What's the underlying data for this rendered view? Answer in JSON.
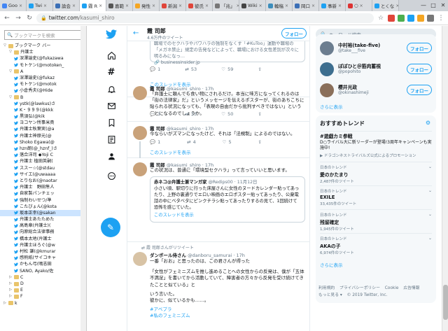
{
  "browser": {
    "tabs": [
      {
        "label": "Goo",
        "color": "#4285f4"
      },
      {
        "label": "Twi",
        "color": "#1da1f2"
      },
      {
        "label": "論会",
        "color": "#3b6fb6"
      },
      {
        "label": "霧 R",
        "color": "#1da1f2",
        "active": true
      },
      {
        "label": "嘉範",
        "color": "#555555"
      },
      {
        "label": "発性",
        "color": "#f5a623"
      },
      {
        "label": "新潟",
        "color": "#e0453a"
      },
      {
        "label": "彼氏",
        "color": "#e0453a"
      },
      {
        "label": "「兆」",
        "color": "#777777"
      },
      {
        "label": "Wiki",
        "color": "#444444"
      },
      {
        "label": "輪稿",
        "color": "#3c8dbc"
      },
      {
        "label": "岡口",
        "color": "#3b6fb6"
      },
      {
        "label": "事新",
        "color": "#1da1f2"
      },
      {
        "label": "○",
        "color": "#d33"
      },
      {
        "label": "とくな",
        "color": "#1da1f2"
      }
    ],
    "url_host": "twitter.com",
    "url_path": "/kasumi_shiro",
    "win_controls": [
      "—",
      "□",
      "✕"
    ],
    "ext_colors": [
      "#e0453a",
      "#4caf50",
      "#1da1f2",
      "#f5a623",
      "#777777"
    ]
  },
  "bookmarks": {
    "search_placeholder": "ブックマークを検索",
    "items": [
      {
        "text": "ブックマーク バー",
        "type": "folder",
        "depth": 0,
        "arrow": "▽"
      },
      {
        "text": "弁護士",
        "type": "folder",
        "depth": 1,
        "arrow": "▽"
      },
      {
        "text": "深澤諭史(@fukazawa",
        "type": "tw",
        "depth": 2
      },
      {
        "text": "モトケン(@motoken_",
        "type": "tw",
        "depth": 2
      },
      {
        "text": "A",
        "type": "folder",
        "depth": 1,
        "arrow": "▽"
      },
      {
        "text": "深澤諭史(@fukaz",
        "type": "tw",
        "depth": 2
      },
      {
        "text": "モトケン(@motok",
        "type": "tw",
        "depth": 2
      },
      {
        "text": "小倉秀夫(@Hide",
        "type": "tw",
        "depth": 2
      },
      {
        "text": "B",
        "type": "folder",
        "depth": 1,
        "arrow": "▽"
      },
      {
        "text": "ystk(@lawkus)さ",
        "type": "tw",
        "depth": 2
      },
      {
        "text": "K・９９９(@kkk",
        "type": "tw",
        "depth": 2
      },
      {
        "text": "黒須弘(@kik",
        "type": "tw",
        "depth": 2
      },
      {
        "text": "ヨコヤン所事米貴",
        "type": "tw",
        "depth": 2
      },
      {
        "text": "弁護士秋葉実(@a",
        "type": "tw",
        "depth": 2
      },
      {
        "text": "弁護士神原元(@",
        "type": "tw",
        "depth": 2
      },
      {
        "text": "Shoko Egawa(@",
        "type": "tw",
        "depth": 2
      },
      {
        "text": "hzn朗(@_hznf_)さ",
        "type": "tw",
        "depth": 2
      },
      {
        "text": "落合洋司 ◆Yoji C",
        "type": "tw",
        "depth": 2
      },
      {
        "text": "弁護士 植田英嗣(",
        "type": "tw",
        "depth": 2
      },
      {
        "text": "ススー☆(@stdau",
        "type": "tw",
        "depth": 2
      },
      {
        "text": "サイエ(@uwaaaa",
        "type": "tw",
        "depth": 2
      },
      {
        "text": "とりなお(@naotar",
        "type": "tw",
        "depth": 2
      },
      {
        "text": "弁護士　野田隼人",
        "type": "tw",
        "depth": 2
      },
      {
        "text": "自家製パンチェッ",
        "type": "tw",
        "depth": 2
      },
      {
        "text": "強制わいせつ/準",
        "type": "tw",
        "depth": 2
      },
      {
        "text": "こたびょん(@kota",
        "type": "tw",
        "depth": 2
      },
      {
        "text": "坂本正幸(@sakan",
        "type": "tw",
        "depth": 2,
        "selected": true
      },
      {
        "text": "弁護士あたためた",
        "type": "tw",
        "depth": 2
      },
      {
        "text": "高島章(弁護士)(",
        "type": "tw",
        "depth": 2
      },
      {
        "text": "向原総合法律事務",
        "type": "tw",
        "depth": 2
      },
      {
        "text": "橋本太地(弁護士",
        "type": "tw",
        "depth": 2
      },
      {
        "text": "弁護士ほろぐ(@w",
        "type": "tw",
        "depth": 2
      },
      {
        "text": "村松 謙(@kmurar",
        "type": "tw",
        "depth": 2
      },
      {
        "text": "感熱紙(サイコキャ",
        "type": "tw",
        "depth": 2
      },
      {
        "text": "かもん弓(鳴志田",
        "type": "tw",
        "depth": 2
      },
      {
        "text": "SANO, Ayako/佐",
        "type": "tw",
        "depth": 2
      },
      {
        "text": "C",
        "type": "folder",
        "depth": 1,
        "arrow": "▷"
      },
      {
        "text": "D",
        "type": "folder",
        "depth": 1,
        "arrow": "▷"
      },
      {
        "text": "E",
        "type": "folder",
        "depth": 1,
        "arrow": "▷"
      },
      {
        "text": "F",
        "type": "folder",
        "depth": 1,
        "arrow": "▷"
      },
      {
        "text": "k",
        "type": "folder",
        "depth": 0,
        "arrow": "▷"
      }
    ]
  },
  "profile": {
    "back": "←",
    "name": "霞 司郎",
    "tweet_count": "4.6万件のツイート",
    "follow_label": "フォロー"
  },
  "tweets": {
    "t0": {
      "body": "職場でのセクハラやパワハラの強制をなくす「#KuToo」運動や職場の「メガネ禁止」規定の告発などによって、職場における女性差別が次々に明るみになっ…",
      "link": "🔗 businessinsider.jp",
      "reply": "1",
      "retweet": "53",
      "like": "59",
      "show_thread": "このスレッドを表示"
    },
    "t1": {
      "name": "霞 司郎",
      "handle": "@kasumi_shiro",
      "time": "· 17h",
      "body": "「弁護士に頼んでも食い物にされるだけ。本当に味方になってくれるのは「街の法律家」だ」というメッセージを伝えるポスターが、街のあちこちに貼られる状況になっても、「表現の自由だから批判すべきではない」ということになるのでしょうか。",
      "reply": "3",
      "retweet": "33",
      "like": "50"
    },
    "t2": {
      "name": "霞 司郎",
      "handle": "@kasumi_shiro",
      "time": "· 17h",
      "body": "今ならいがズマンになったけど、それは「法規制」によるのではない。",
      "reply": "1",
      "retweet": "4",
      "like": "5",
      "show_thread": "このスレッドを表示"
    },
    "t3": {
      "name": "霞 司郎",
      "handle": "@kasumi_shiro",
      "time": "· 17h",
      "body": "この状況は、普通に「環境型セクハラ」って言っていいと思います。",
      "quote_name": "赤ネコ@弁護士兼マンガ家",
      "quote_handle": "@Redips00 · 11月12日",
      "quote_body": "小さい頃、駅切りに行った床屋さんに女性のヌードカレンダー貼ってあったり、上野の裏通りでエロい映画のエロポスター貼ってあったり、公衆電話の中にベタベタにピンクチラシ貼ってあったりするの見て、1回続けて恐怖を感じていた。",
      "quote_thread": "このスレッドを表示"
    },
    "t4": {
      "rt_line": "霞 司郎さんがリツイート",
      "name": "ダンボール侍さん",
      "handle": "@danboru_samurai",
      "time": "· 17h",
      "lead": "一番「おお」と思ったのは、この君さんが得った",
      "body": "「女性がフェミニズムを推し進めることへの女性からの反発は、僕が「五体不満足」を書いてから活動していて、障害者の方々から反発を受け続けてきたことと似ている」と",
      "body2": "いう言いた。",
      "body3": "彼かに、似ているかも……。",
      "tags": "#アベプラ",
      "tags2": "#私のフェミニズム"
    }
  },
  "right": {
    "search_placeholder": "キーワード検索",
    "who": [
      {
        "name": "中村裕(take-five)",
        "handle": "@take___five",
        "follow": "フォロー"
      },
      {
        "name": "ぽぽひと＠筋肉蓄視",
        "handle": "@popohito",
        "follow": "フォロー"
      },
      {
        "name": "櫻井光政",
        "handle": "@okinashimeji",
        "follow": "フォロー"
      }
    ],
    "who_more": "さらに表示",
    "trends_title": "おすすめトレンド",
    "gear": "⚙",
    "promo": {
      "name": "#遊戯カミ参戦",
      "desc": "D○ライバル大に新リーダーが登場!3周年キャンペーンも実施中!",
      "promoted": "▶ ドラゴンネストライバルズ公式によるプロモーション"
    },
    "trends": [
      {
        "cat": "日本のトレンド",
        "name": "愛のかたまり",
        "count": "2,487件のツイート"
      },
      {
        "cat": "日本のトレンド",
        "name": "EXILE",
        "count": "33,435件のツイート"
      },
      {
        "cat": "日本のトレンド",
        "name": "残留確定",
        "count": "1,945件のツイート"
      },
      {
        "cat": "日本のトレンド",
        "name": "AKAの子",
        "count": "6,974件のツイート"
      }
    ],
    "trends_more": "さらに表示",
    "footer": [
      "利用規約",
      "プライバシーポリシー",
      "Cookie",
      "広告情報",
      "もっと見る ▾",
      "© 2019 Twitter, Inc."
    ]
  },
  "colors": {
    "accent": "#1da1f2"
  }
}
